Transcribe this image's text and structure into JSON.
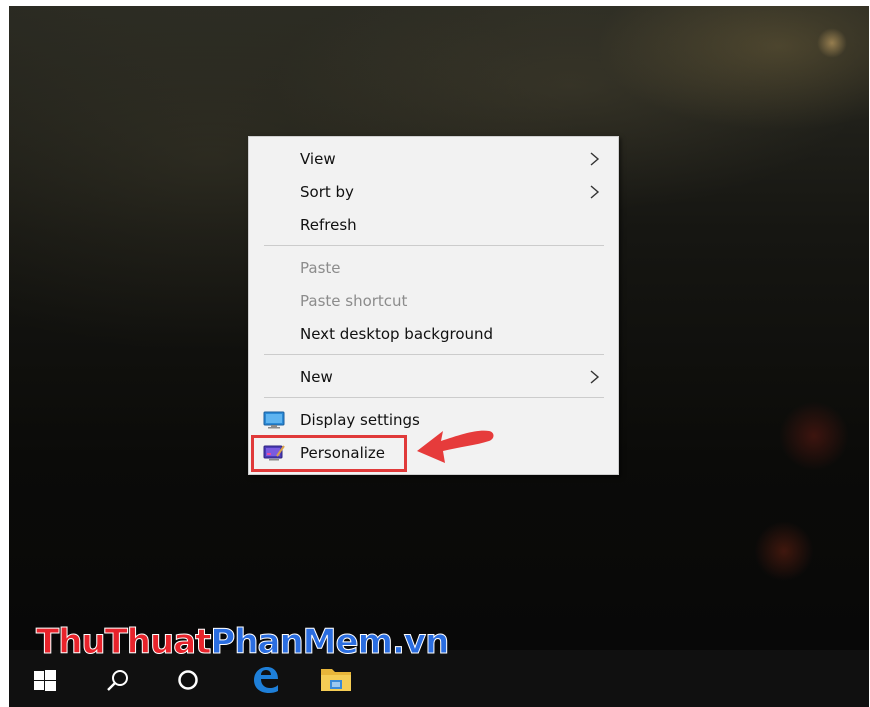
{
  "context_menu": {
    "items": [
      {
        "label": "View",
        "has_submenu": true,
        "disabled": false
      },
      {
        "label": "Sort by",
        "has_submenu": true,
        "disabled": false
      },
      {
        "label": "Refresh",
        "has_submenu": false,
        "disabled": false
      },
      {
        "label": "Paste",
        "has_submenu": false,
        "disabled": true
      },
      {
        "label": "Paste shortcut",
        "has_submenu": false,
        "disabled": true
      },
      {
        "label": "Next desktop background",
        "has_submenu": false,
        "disabled": false
      },
      {
        "label": "New",
        "has_submenu": true,
        "disabled": false
      },
      {
        "label": "Display settings",
        "icon": "display-settings-icon",
        "disabled": false
      },
      {
        "label": "Personalize",
        "icon": "personalize-icon",
        "disabled": false,
        "highlighted": true
      }
    ]
  },
  "annotation": {
    "arrow_color": "#e63b3b",
    "highlight_color": "#e03a3a"
  },
  "taskbar": {
    "icons": [
      "windows-start-icon",
      "search-icon",
      "cortana-icon",
      "edge-icon",
      "file-explorer-icon"
    ]
  },
  "watermark": {
    "part1": "ThuThuat",
    "part2": "PhanMem.vn"
  }
}
